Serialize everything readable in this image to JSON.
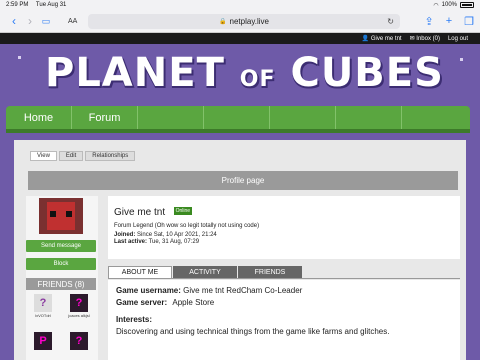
{
  "status_bar": {
    "time": "2:59 PM",
    "date": "Tue Aug 31",
    "battery": "100%"
  },
  "browser": {
    "aa": "AA",
    "url": "netplay.live"
  },
  "topbar": {
    "user": "Give me tnt",
    "inbox": "Inbox (0)",
    "logout": "Log out"
  },
  "logo": {
    "planet": "PLANET",
    "of": "OF",
    "cubes": "CUBES"
  },
  "nav": {
    "items": [
      "Home",
      "Forum",
      "",
      "",
      "",
      "",
      ""
    ]
  },
  "tabs_top": [
    "View",
    "Edit",
    "Relationships"
  ],
  "profile_header": "Profile page",
  "sidebar": {
    "send_message": "Send message",
    "block": "Block",
    "friends_title": "FRIENDS (8)",
    "friends": [
      {
        "name": "lxVOTdrl",
        "pic": "?"
      },
      {
        "name": "jcaces alkjsl",
        "pic": "?"
      }
    ]
  },
  "profile": {
    "name": "Give me tnt",
    "status": "Online",
    "rank": "Forum Legend (Oh wow so legit totally not using code)",
    "joined_label": "Joined:",
    "joined_value": "Since Sat, 10 Apr 2021, 21:24",
    "active_label": "Last active:",
    "active_value": "Tue, 31 Aug, 07:29"
  },
  "profile_tabs": [
    "ABOUT ME",
    "ACTIVITY",
    "FRIENDS"
  ],
  "about": {
    "username_label": "Game username:",
    "username_value": "Give me tnt RedCham Co-Leader",
    "server_label": "Game server:",
    "server_value": "Apple Store",
    "interests_label": "Interests:",
    "interests_value": "Discovering and using technical things from the game like farms and glitches."
  },
  "colors": {
    "banner": "#6e5aa8",
    "nav_green": "#5aa640",
    "header_gray": "#9a9a9a"
  }
}
